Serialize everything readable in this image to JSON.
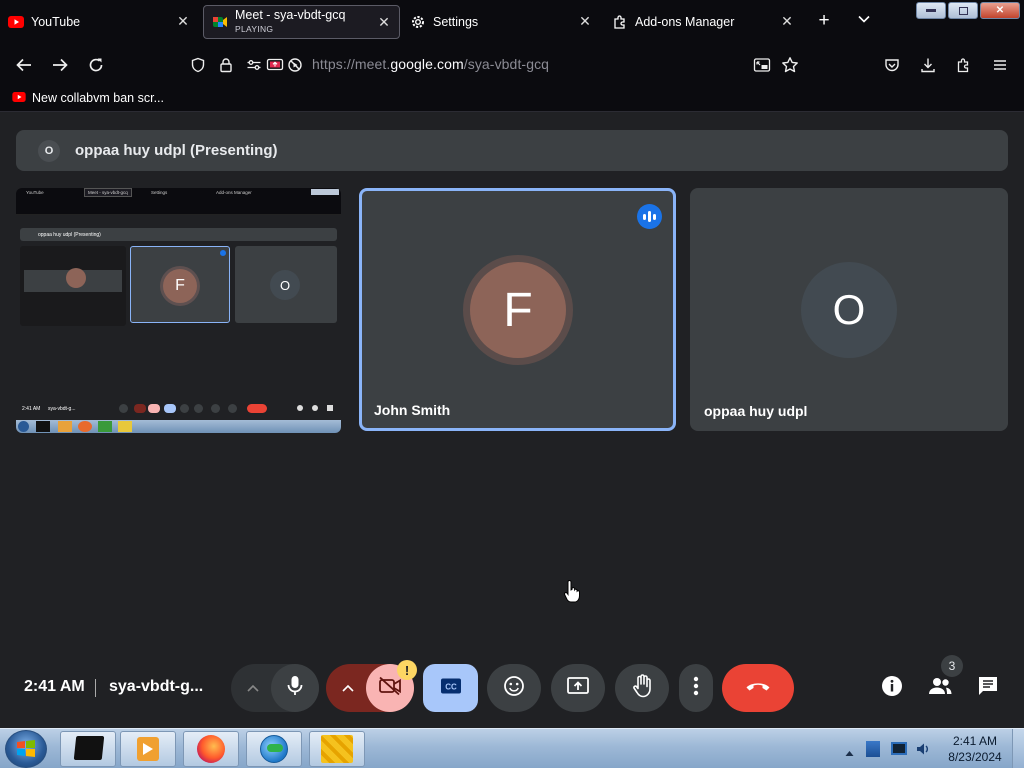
{
  "browser": {
    "tabs": [
      {
        "title": "YouTube",
        "icon": "youtube-icon"
      },
      {
        "title": "Meet - sya-vbdt-gcq",
        "subtitle": "PLAYING",
        "icon": "google-meet-icon"
      },
      {
        "title": "Settings",
        "icon": "gear-icon"
      },
      {
        "title": "Add-ons Manager",
        "icon": "puzzle-icon"
      }
    ],
    "url_prefix": "https://meet.",
    "url_domain": "google.com",
    "url_path": "/sya-vbdt-gcq",
    "bookmark": "New collabvm ban scr..."
  },
  "meet": {
    "presenting_banner": {
      "avatar": "O",
      "text": "oppaa huy udpl (Presenting)"
    },
    "shared_screen": {
      "tab1": "YouTube",
      "tab2": "Meet - sya-vbdt-gcq",
      "tab3": "Settings",
      "tab4": "Add-ons Manager",
      "banner": "oppaa huy udpl (Presenting)",
      "tile_f": "F",
      "tile_o": "O",
      "time": "2:41 AM",
      "code": "sya-vbdt-g..."
    },
    "participants": [
      {
        "name": "John Smith",
        "initial": "F",
        "avatar_color": "#8d6458",
        "speaking": true
      },
      {
        "name": "oppaa huy udpl",
        "initial": "O",
        "avatar_color": "#424a51",
        "speaking": false
      }
    ],
    "controls": {
      "time": "2:41 AM",
      "meeting_code": "sya-vbdt-g...",
      "alert_badge": "!",
      "people_count": "3"
    },
    "colors": {
      "active_border": "#8ab4f8",
      "leave": "#ea4335",
      "cc": "#a8c7fa",
      "camera_off": "#f9b4b3"
    }
  },
  "taskbar": {
    "time": "2:41 AM",
    "date": "8/23/2024"
  }
}
